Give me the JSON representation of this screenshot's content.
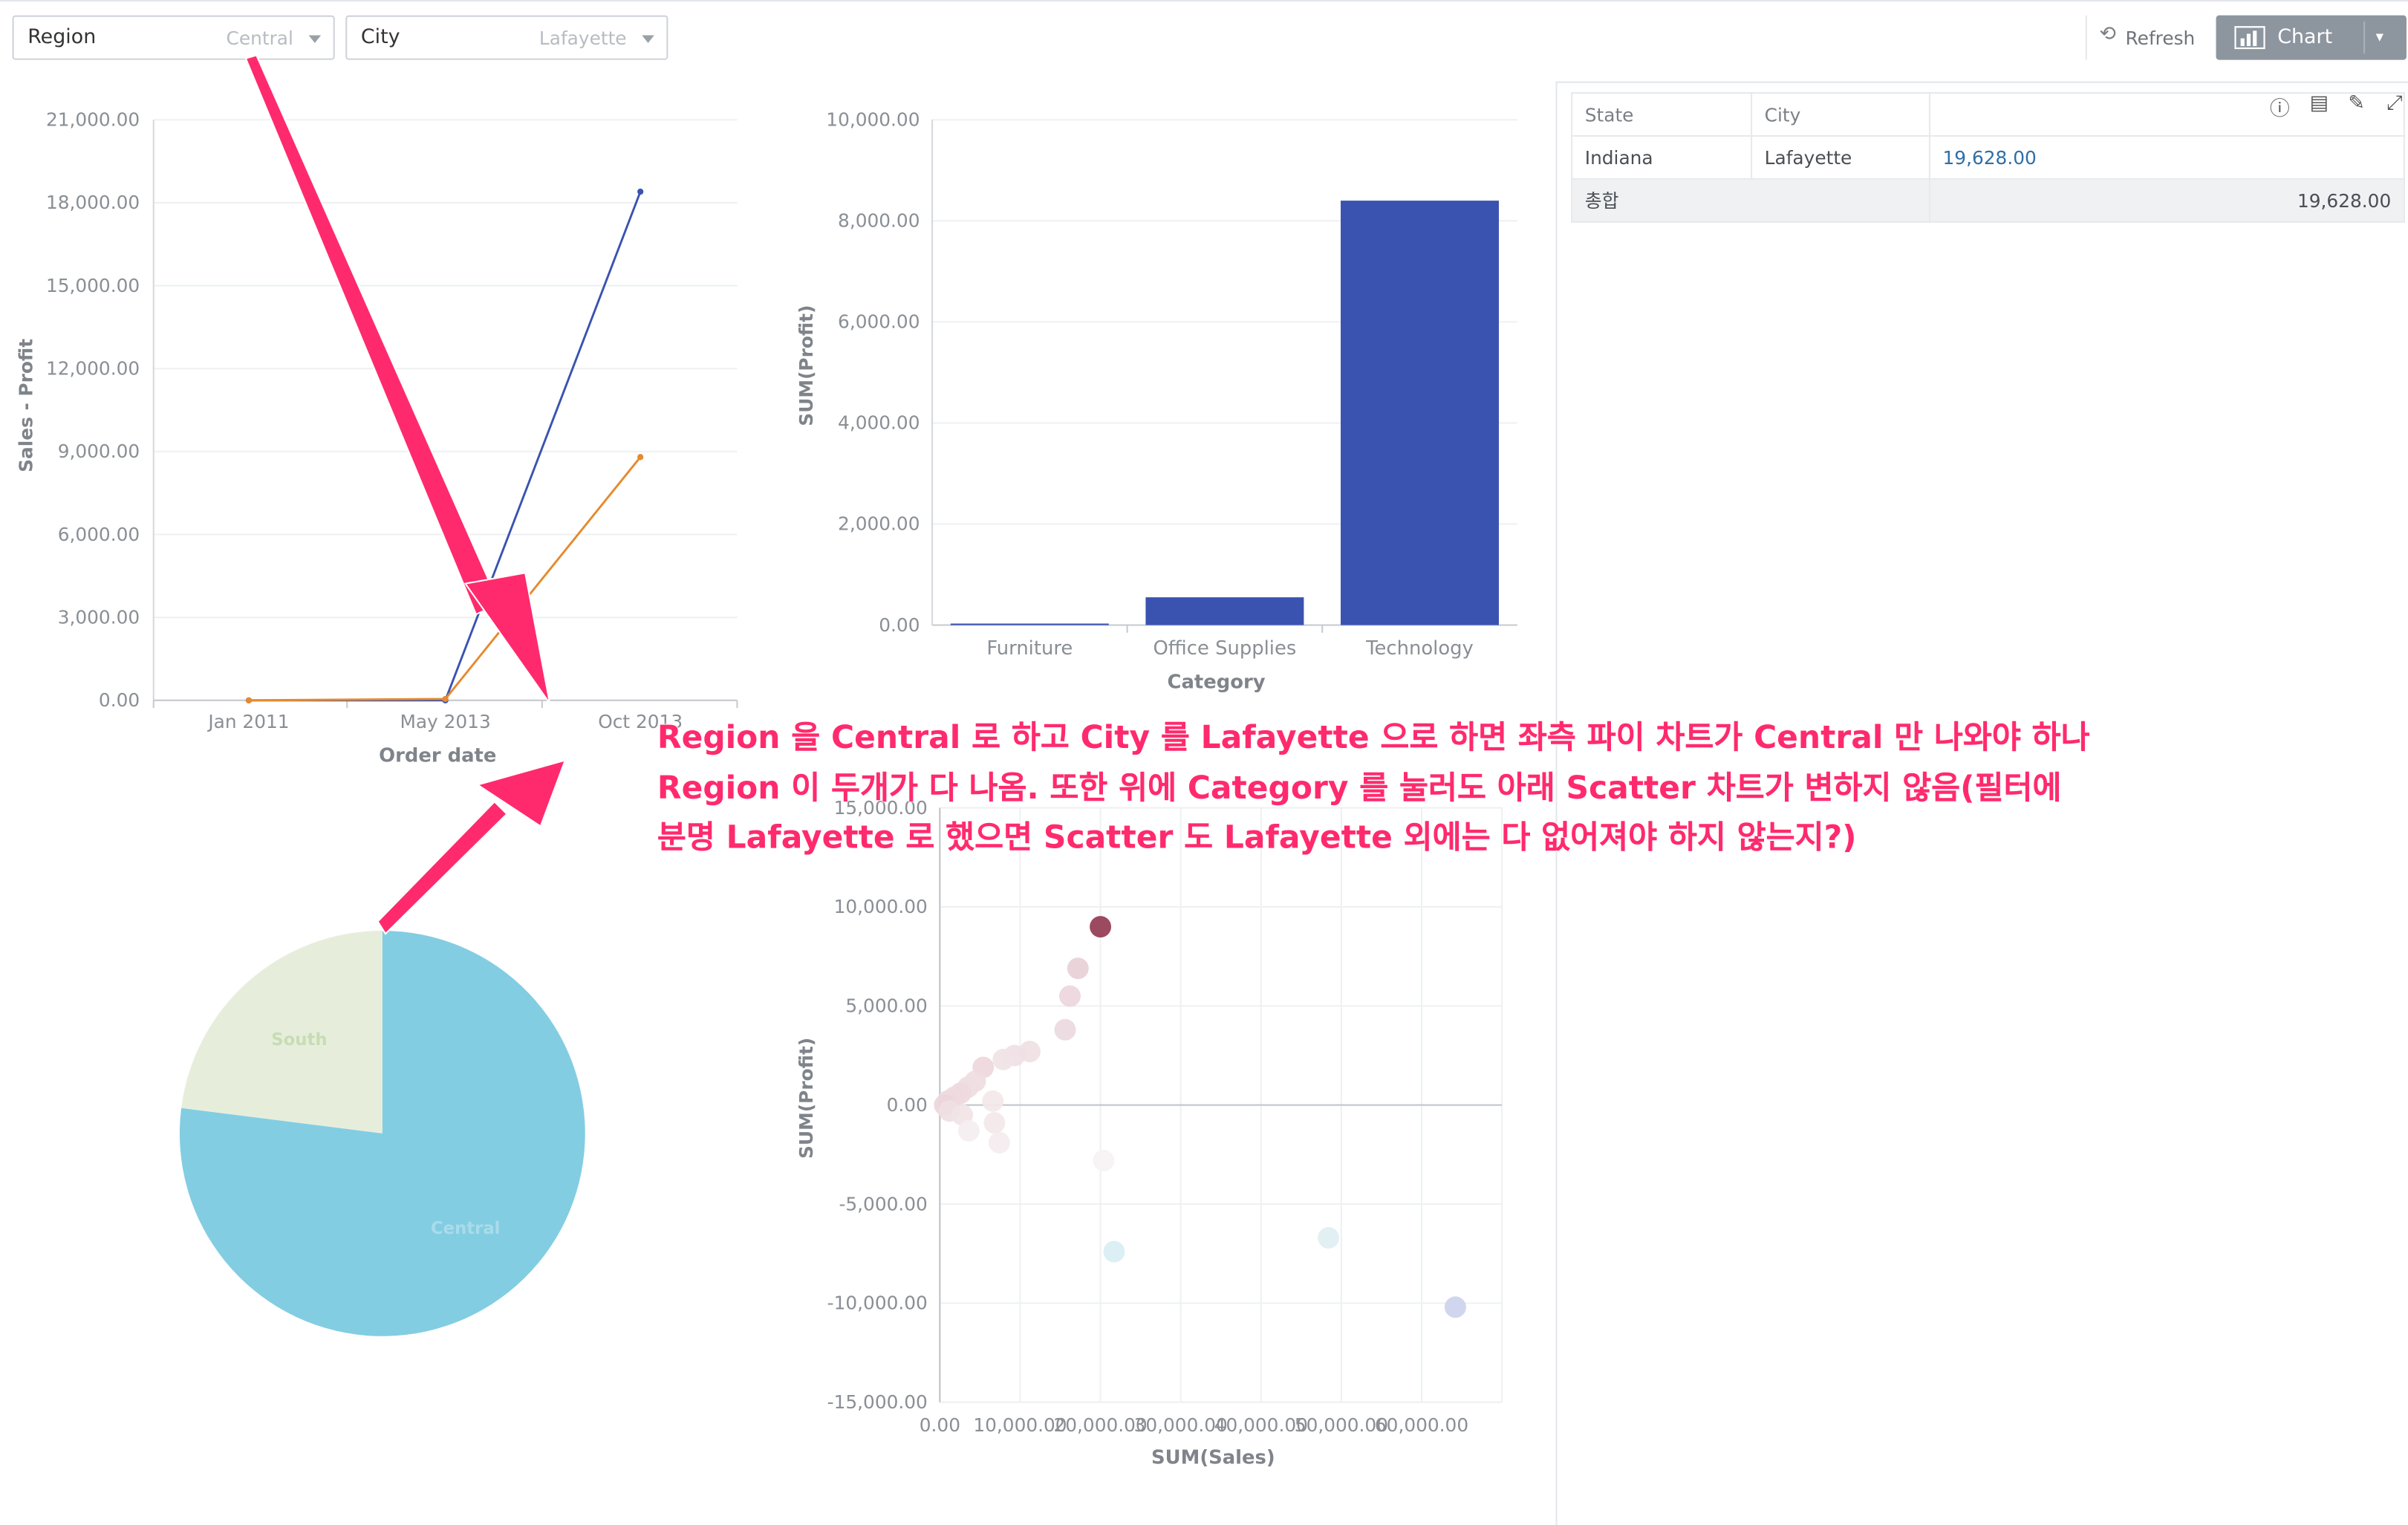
{
  "filters": [
    {
      "label": "Region",
      "value": "Central"
    },
    {
      "label": "City",
      "value": "Lafayette"
    }
  ],
  "toolbar": {
    "refresh_label": "Refresh",
    "chart_label": "Chart"
  },
  "colors": {
    "blue": "#3a53b0",
    "orange": "#e58a2e",
    "pie_central": "#83cde2",
    "pie_south": "#e6eedb",
    "scatter_dark": "#943b52",
    "annotation": "#ff2a6d"
  },
  "table": {
    "headers": [
      "State",
      "City",
      ""
    ],
    "rows": [
      [
        "Indiana",
        "Lafayette",
        "19,628.00"
      ]
    ],
    "total": {
      "label": "총합",
      "value": "19,628.00"
    }
  },
  "annotation": {
    "text": "Region 을 Central 로 하고 City 를 Lafayette 으로 하면 좌측 파이 차트가 Central 만 나와야 하나\nRegion 이 두개가 다 나옴. 또한 위에 Category 를 눌러도 아래 Scatter 차트가 변하지 않음(필터에\n분명 Lafayette 로 했으면 Scatter 도 Lafayette 외에는 다 없어져야 하지 않는지?)"
  },
  "chart_data": [
    {
      "type": "line",
      "x": [
        "Jan 2011",
        "May 2013",
        "Oct 2013"
      ],
      "xlabel": "Order date",
      "ylabel": "Sales - Profit",
      "yticks": [
        "0.00",
        "3,000.00",
        "6,000.00",
        "9,000.00",
        "12,000.00",
        "15,000.00",
        "18,000.00",
        "21,000.00"
      ],
      "ylim": [
        0,
        21000
      ],
      "series": [
        {
          "color": "#3a53b0",
          "values": [
            0,
            0,
            18400
          ]
        },
        {
          "color": "#e58a2e",
          "values": [
            0,
            50,
            8800
          ]
        }
      ]
    },
    {
      "type": "bar",
      "categories": [
        "Furniture",
        "Office Supplies",
        "Technology"
      ],
      "values": [
        30,
        550,
        8400
      ],
      "xlabel": "Category",
      "ylabel": "SUM(Profit)",
      "yticks": [
        "0.00",
        "2,000.00",
        "4,000.00",
        "6,000.00",
        "8,000.00",
        "10,000.00"
      ],
      "ylim": [
        0,
        10000
      ]
    },
    {
      "type": "pie",
      "slices": [
        {
          "label": "South",
          "value": 23,
          "color": "#e6eedb"
        },
        {
          "label": "Central",
          "value": 77,
          "color": "#83cde2"
        }
      ]
    },
    {
      "type": "scatter",
      "xlabel": "SUM(Sales)",
      "ylabel": "SUM(Profit)",
      "xticks": [
        "0.00",
        "10,000.00",
        "20,000.00",
        "30,000.00",
        "40,000.00",
        "50,000.00",
        "60,000.00"
      ],
      "yticks": [
        "-15,000.00",
        "-10,000.00",
        "-5,000.00",
        "0.00",
        "5,000.00",
        "10,000.00",
        "15,000.00"
      ],
      "xlim": [
        0,
        70000
      ],
      "ylim": [
        -15000,
        15000
      ],
      "points": [
        {
          "x": 20000,
          "y": 9000,
          "color": "#943b52"
        },
        {
          "x": 17200,
          "y": 6900,
          "color": "#e8cfd6"
        },
        {
          "x": 16200,
          "y": 5500,
          "color": "#ebd6dc"
        },
        {
          "x": 15600,
          "y": 3800,
          "color": "#ecd9de"
        },
        {
          "x": 11200,
          "y": 2700,
          "color": "#efdfe3"
        },
        {
          "x": 9300,
          "y": 2500,
          "color": "#efe0e4"
        },
        {
          "x": 7900,
          "y": 2300,
          "color": "#f1e3e6"
        },
        {
          "x": 5400,
          "y": 1900,
          "color": "#eed7dd"
        },
        {
          "x": 4400,
          "y": 1200,
          "color": "#efdde2"
        },
        {
          "x": 3500,
          "y": 900,
          "color": "#efdde2"
        },
        {
          "x": 2600,
          "y": 600,
          "color": "#eed9de"
        },
        {
          "x": 1800,
          "y": 400,
          "color": "#eed9de"
        },
        {
          "x": 1000,
          "y": 200,
          "color": "#eed9de"
        },
        {
          "x": 600,
          "y": 0,
          "color": "#ecd6db"
        },
        {
          "x": 1200,
          "y": -300,
          "color": "#efdfe3"
        },
        {
          "x": 2800,
          "y": -500,
          "color": "#f1e4e7"
        },
        {
          "x": 6600,
          "y": 200,
          "color": "#f3e8ea"
        },
        {
          "x": 6800,
          "y": -900,
          "color": "#f3e8ea"
        },
        {
          "x": 3600,
          "y": -1300,
          "color": "#f5eef0"
        },
        {
          "x": 7400,
          "y": -1900,
          "color": "#f4ecee"
        },
        {
          "x": 20400,
          "y": -2800,
          "color": "#f7f3f4"
        },
        {
          "x": 21700,
          "y": -7400,
          "color": "#d8eef3"
        },
        {
          "x": 48400,
          "y": -6700,
          "color": "#dfeff3"
        },
        {
          "x": 64200,
          "y": -10200,
          "color": "#ccd2eb"
        }
      ]
    }
  ]
}
